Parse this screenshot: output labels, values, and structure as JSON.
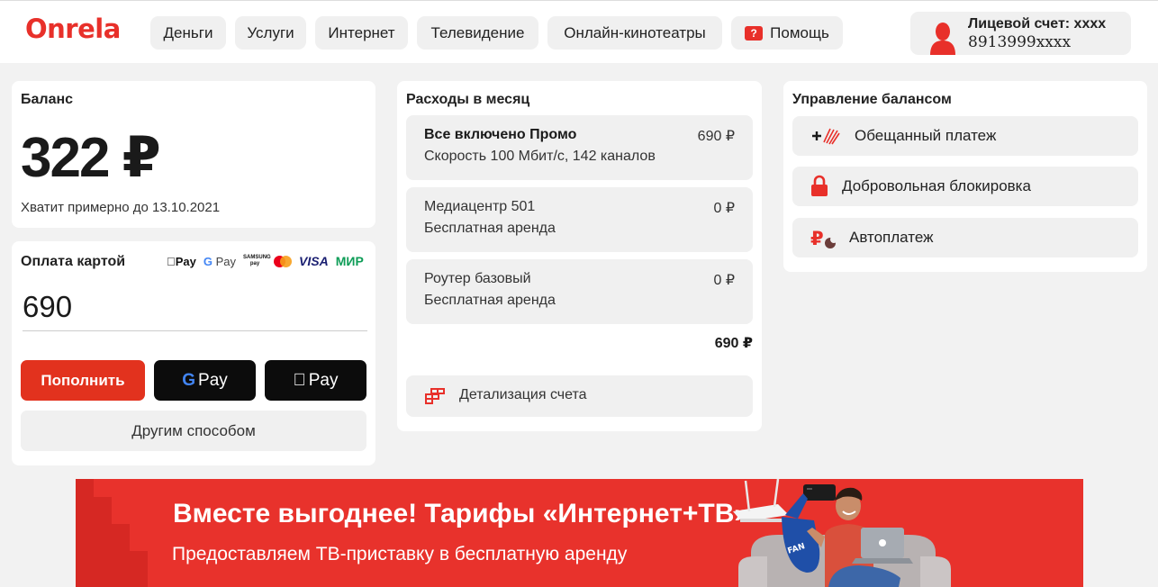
{
  "header": {
    "logo": "Onrela",
    "nav": [
      "Деньги",
      "Услуги",
      "Интернет",
      "Телевидение",
      "Онлайн-кинотеатры"
    ],
    "help_label": "Помощь",
    "account_title": "Лицевой счет: xxxx",
    "account_number": "8913999xxxx"
  },
  "balance": {
    "title": "Баланс",
    "amount": "322 ₽",
    "note": "Хватит примерно до 13.10.2021"
  },
  "card_payment": {
    "title": "Оплата картой",
    "logos": [
      "Pay",
      "G Pay",
      "SAMSUNG pay",
      "VISA",
      "МИР"
    ],
    "amount_value": "690",
    "topup_label": "Пополнить",
    "gpay_label": "Pay",
    "applepay_label": "Pay",
    "other_label": "Другим способом"
  },
  "expenses": {
    "title": "Расходы в месяц",
    "items": [
      {
        "name": "Все включено Промо",
        "sub": "Скорость 100 Мбит/с, 142 каналов",
        "price": "690 ₽"
      },
      {
        "name": "Медиацентр 501",
        "sub": "Бесплатная аренда",
        "price": "0 ₽"
      },
      {
        "name": "Роутер базовый",
        "sub": "Бесплатная аренда",
        "price": "0 ₽"
      }
    ],
    "total": "690 ₽",
    "details_label": "Детализация счета"
  },
  "balance_management": {
    "title": "Управление балансом",
    "items": [
      {
        "label": "Обещанный платеж",
        "icon": "promise-payment-icon"
      },
      {
        "label": "Добровольная блокировка",
        "icon": "lock-icon"
      },
      {
        "label": "Автоплатеж",
        "icon": "autopay-icon"
      }
    ]
  },
  "banner": {
    "title": "Вместе выгоднее! Тарифы «Интернет+ТВ»",
    "subtitle": "Предоставляем ТВ-приставку в бесплатную аренду",
    "badge_text": "FAN"
  },
  "colors": {
    "accent": "#e8302a",
    "background": "#f2f2f2",
    "card": "#ffffff",
    "button_gray": "#f0f0f0"
  }
}
